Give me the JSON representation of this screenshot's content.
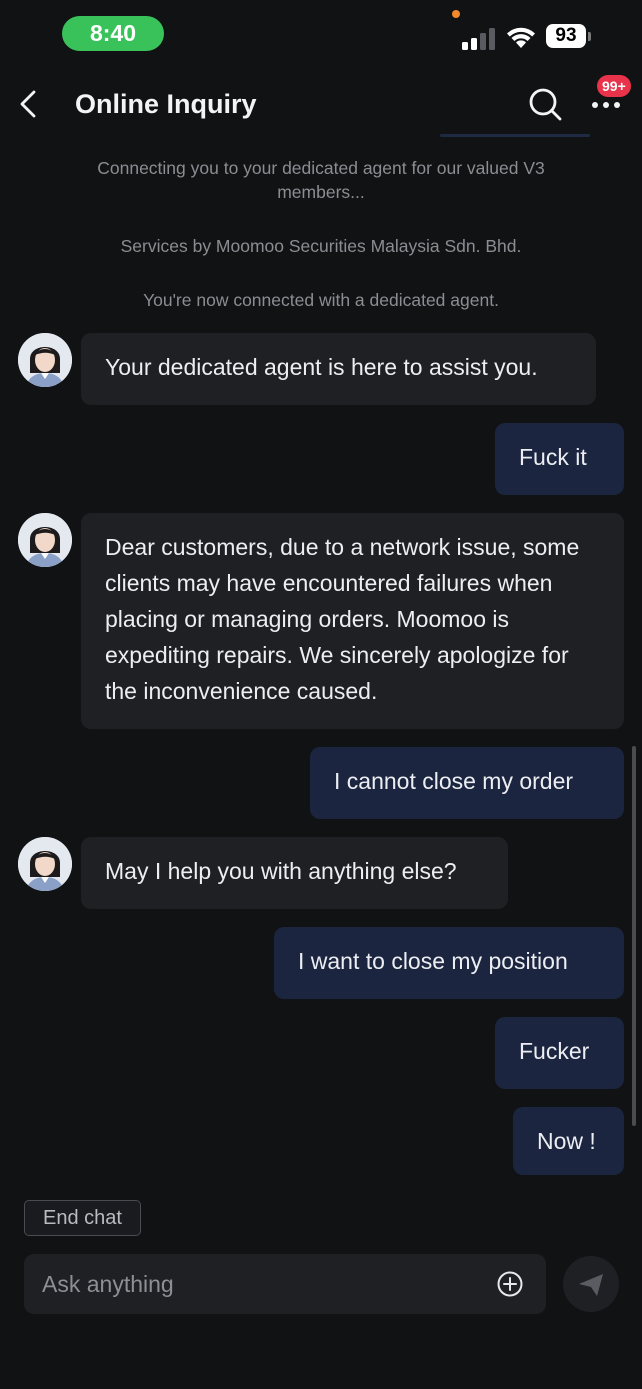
{
  "status_bar": {
    "time": "8:40",
    "battery": "93",
    "signal_icon": "cellular-signal-icon",
    "wifi_icon": "wifi-icon"
  },
  "header": {
    "title": "Online Inquiry",
    "back_icon": "chevron-left-icon",
    "search_icon": "search-icon",
    "more_icon": "more-dots-icon",
    "badge": "99+"
  },
  "system_notes": [
    "Connecting you to your dedicated agent for our valued V3 members...",
    "Services by Moomoo Securities Malaysia Sdn. Bhd.",
    "You're now connected with a dedicated agent."
  ],
  "messages": [
    {
      "from": "agent",
      "text": "Your dedicated agent is here to assist you."
    },
    {
      "from": "user",
      "text": "Fuck it"
    },
    {
      "from": "agent",
      "text": "Dear customers, due to a network issue, some clients may have encountered failures when placing or managing orders. Moomoo is expediting repairs. We sincerely apologize for the inconvenience caused."
    },
    {
      "from": "user",
      "text": "I cannot close my order"
    },
    {
      "from": "agent",
      "text": "May I help you with anything else?"
    },
    {
      "from": "user",
      "text": "I want to close my position"
    },
    {
      "from": "user",
      "text": "Fucker"
    },
    {
      "from": "user",
      "text": "Now !"
    }
  ],
  "footer": {
    "end_chat_label": "End chat",
    "input_placeholder": "Ask anything",
    "add_icon": "plus-circle-icon",
    "send_icon": "send-paper-plane-icon"
  },
  "colors": {
    "background": "#111214",
    "agent_bubble": "#1f2024",
    "user_bubble": "#1b2540",
    "time_pill": "#3ac25a",
    "badge": "#e8334a"
  }
}
